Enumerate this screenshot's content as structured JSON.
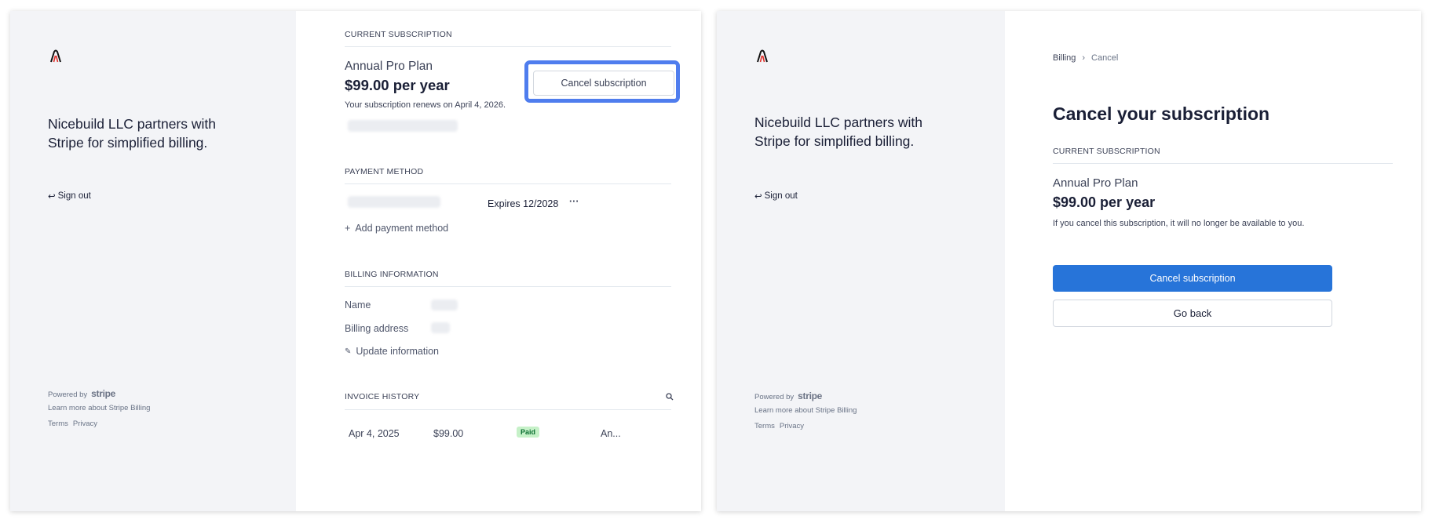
{
  "left": {
    "sidebar": {
      "tagline": "Nicebuild LLC partners with Stripe for simplified billing.",
      "sign_out": "Sign out",
      "powered_by": "Powered by",
      "brand": "stripe",
      "learn_more": "Learn more about Stripe Billing",
      "terms": "Terms",
      "privacy": "Privacy"
    },
    "subscription": {
      "heading": "CURRENT SUBSCRIPTION",
      "plan_name": "Annual Pro Plan",
      "price": "$99.00 per year",
      "renews": "Your subscription renews on April 4, 2026.",
      "cancel_label": "Cancel subscription"
    },
    "payment": {
      "heading": "PAYMENT METHOD",
      "expires": "Expires 12/2028",
      "more": "···",
      "add_label": "Add payment method"
    },
    "billing": {
      "heading": "BILLING INFORMATION",
      "name_label": "Name",
      "address_label": "Billing address",
      "update_label": "Update information"
    },
    "invoices": {
      "heading": "INVOICE HISTORY",
      "rows": [
        {
          "date": "Apr 4, 2025",
          "amount": "$99.00",
          "status": "Paid",
          "desc": "An..."
        }
      ]
    }
  },
  "right": {
    "sidebar": {
      "tagline": "Nicebuild LLC partners with Stripe for simplified billing.",
      "sign_out": "Sign out",
      "powered_by": "Powered by",
      "brand": "stripe",
      "learn_more": "Learn more about Stripe Billing",
      "terms": "Terms",
      "privacy": "Privacy"
    },
    "breadcrumb": {
      "billing": "Billing",
      "current": "Cancel"
    },
    "title": "Cancel your subscription",
    "subscription": {
      "heading": "CURRENT SUBSCRIPTION",
      "plan_name": "Annual Pro Plan",
      "price": "$99.00 per year",
      "warning": "If you cancel this subscription, it will no longer be available to you."
    },
    "confirm_label": "Cancel subscription",
    "back_label": "Go back"
  },
  "colors": {
    "accent": "#2774d9",
    "highlight": "#4f7dee",
    "sidebar_bg": "#f3f4f7",
    "paid_bg": "#c6f1c8"
  }
}
